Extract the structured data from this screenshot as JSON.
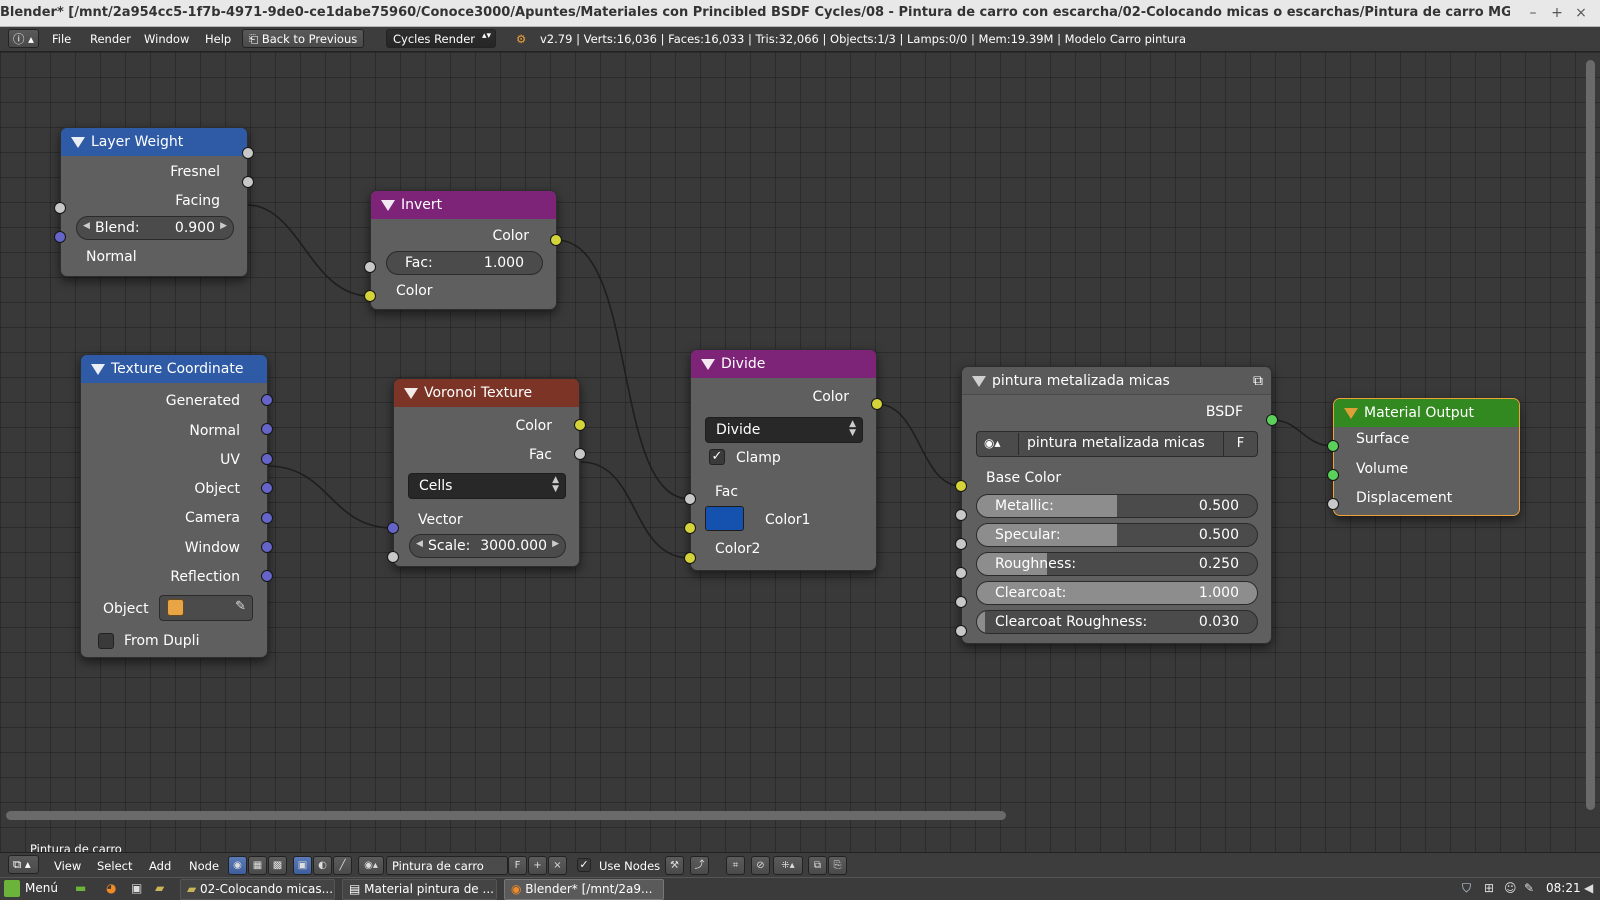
{
  "window": {
    "title": "Blender* [/mnt/2a954cc5-1f7b-4971-9de0-ce1dabe75960/Conoce3000/Apuntes/Materiales con Princibled BSDF Cycles/08 - Pintura de carro con escarcha/02-Colocando micas o escarchas/Pintura de carro MG.blend]",
    "controls": [
      "–",
      "+",
      "×"
    ]
  },
  "info_header": {
    "menus": [
      "File",
      "Render",
      "Window",
      "Help"
    ],
    "back_button": "Back to Previous",
    "render_engine": "Cycles Render",
    "stats": "v2.79 | Verts:16,036 | Faces:16,033 | Tris:32,066 | Objects:1/3 | Lamps:0/0 | Mem:19.39M | Modelo Carro pintura"
  },
  "nodes": {
    "layer_weight": {
      "title": "Layer Weight",
      "outputs": [
        "Fresnel",
        "Facing"
      ],
      "blend_label": "Blend:",
      "blend_value": "0.900",
      "input_normal": "Normal"
    },
    "invert": {
      "title": "Invert",
      "output_color": "Color",
      "fac_label": "Fac:",
      "fac_value": "1.000",
      "input_color": "Color"
    },
    "texture_coordinate": {
      "title": "Texture Coordinate",
      "outputs": [
        "Generated",
        "Normal",
        "UV",
        "Object",
        "Camera",
        "Window",
        "Reflection"
      ],
      "object_label": "Object",
      "from_dupli": "From Dupli"
    },
    "voronoi": {
      "title": "Voronoi Texture",
      "output_color": "Color",
      "output_fac": "Fac",
      "coloring": "Cells",
      "input_vector": "Vector",
      "scale_label": "Scale:",
      "scale_value": "3000.000"
    },
    "divide": {
      "title": "Divide",
      "output_color": "Color",
      "operation": "Divide",
      "clamp_label": "Clamp",
      "clamp_checked": true,
      "input_fac": "Fac",
      "input_color1": "Color1",
      "input_color2": "Color2",
      "color1_swatch": "#1552b0"
    },
    "group": {
      "title": "pintura metalizada micas",
      "output_bsdf": "BSDF",
      "datablock_name": "pintura metalizada micas",
      "fake_user": "F",
      "input_base_color": "Base Color",
      "sliders": [
        {
          "label": "Metallic:",
          "value": "0.500",
          "fraction": 0.5
        },
        {
          "label": "Specular:",
          "value": "0.500",
          "fraction": 0.5
        },
        {
          "label": "Roughness:",
          "value": "0.250",
          "fraction": 0.25
        },
        {
          "label": "Clearcoat:",
          "value": "1.000",
          "fraction": 1.0
        },
        {
          "label": "Clearcoat Roughness:",
          "value": "0.030",
          "fraction": 0.03
        }
      ]
    },
    "material_output": {
      "title": "Material Output",
      "inputs": [
        "Surface",
        "Volume",
        "Displacement"
      ]
    }
  },
  "canvas": {
    "material_label": "Pintura de carro"
  },
  "node_header": {
    "menus": [
      "View",
      "Select",
      "Add",
      "Node"
    ],
    "material_name": "Pintura de carro",
    "fake_user": "F",
    "use_nodes_label": "Use Nodes",
    "use_nodes_checked": true
  },
  "taskbar": {
    "menu_label": "Menú",
    "tasks": [
      "02-Colocando micas...",
      "Material pintura de ...",
      "Blender* [/mnt/2a9..."
    ],
    "clock": "08:21"
  },
  "colors": {
    "socket_color": "#d4d43a",
    "socket_vector": "#6565c9",
    "socket_shader": "#5bd05b",
    "socket_float": "#c8c8c8",
    "header_input": "#2f5ba6",
    "header_converter": "#7d2478",
    "header_texture": "#7b3425",
    "header_output": "#32891f"
  }
}
